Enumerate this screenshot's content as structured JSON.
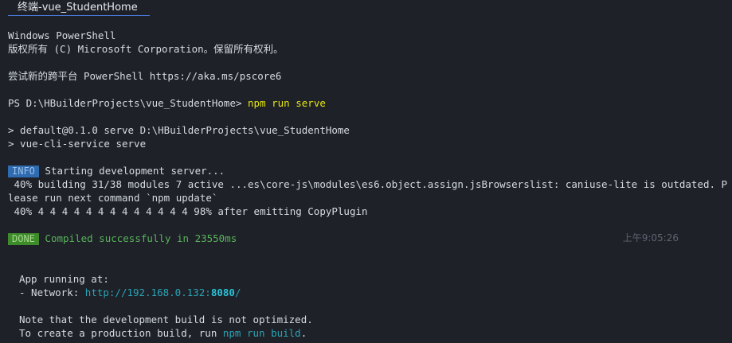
{
  "tab": {
    "title": "终端-vue_StudentHome"
  },
  "terminal": {
    "ps_title": "Windows PowerShell",
    "copyright": "版权所有 (C) Microsoft Corporation。保留所有权利。",
    "try_new": "尝试新的跨平台 PowerShell https://aka.ms/pscore6",
    "prompt": "PS D:\\HBuilderProjects\\vue_StudentHome> ",
    "command": "npm run serve",
    "script_line1": "> default@0.1.0 serve D:\\HBuilderProjects\\vue_StudentHome",
    "script_line2": "> vue-cli-service serve",
    "info_badge": "INFO",
    "info_text": " Starting development server...",
    "build_line1": " 40% building 31/38 modules 7 active ...es\\core-js\\modules\\es6.object.assign.jsBrowserslist: caniuse-lite is outdated. P",
    "build_line2": "lease run next command `npm update`",
    "build_line3": " 40% 4 4 4 4 4 4 4 4 4 4 4 4 4 98% after emitting CopyPlugin",
    "done_badge": "DONE",
    "done_text": " Compiled successfully in 23550ms",
    "timestamp": "上午9:05:26",
    "app_running": "App running at:",
    "network_label": "- Network: ",
    "network_url_base": "http://192.168.0.132:",
    "network_url_port": "8080",
    "network_url_tail": "/",
    "note_line1": "Note that the development build is not optimized.",
    "note_line2_pre": "To create a production build, run ",
    "note_line2_cmd": "npm run build",
    "note_line2_post": "."
  },
  "colors": {
    "background": "#1e2128",
    "text": "#d6dbe3",
    "command": "#e5e510",
    "link": "#2aa4b5",
    "info_badge": "#2f6bb1",
    "done_badge": "#3d8b2a",
    "done_text": "#59b35a",
    "tab_underline": "#4a78d6"
  }
}
